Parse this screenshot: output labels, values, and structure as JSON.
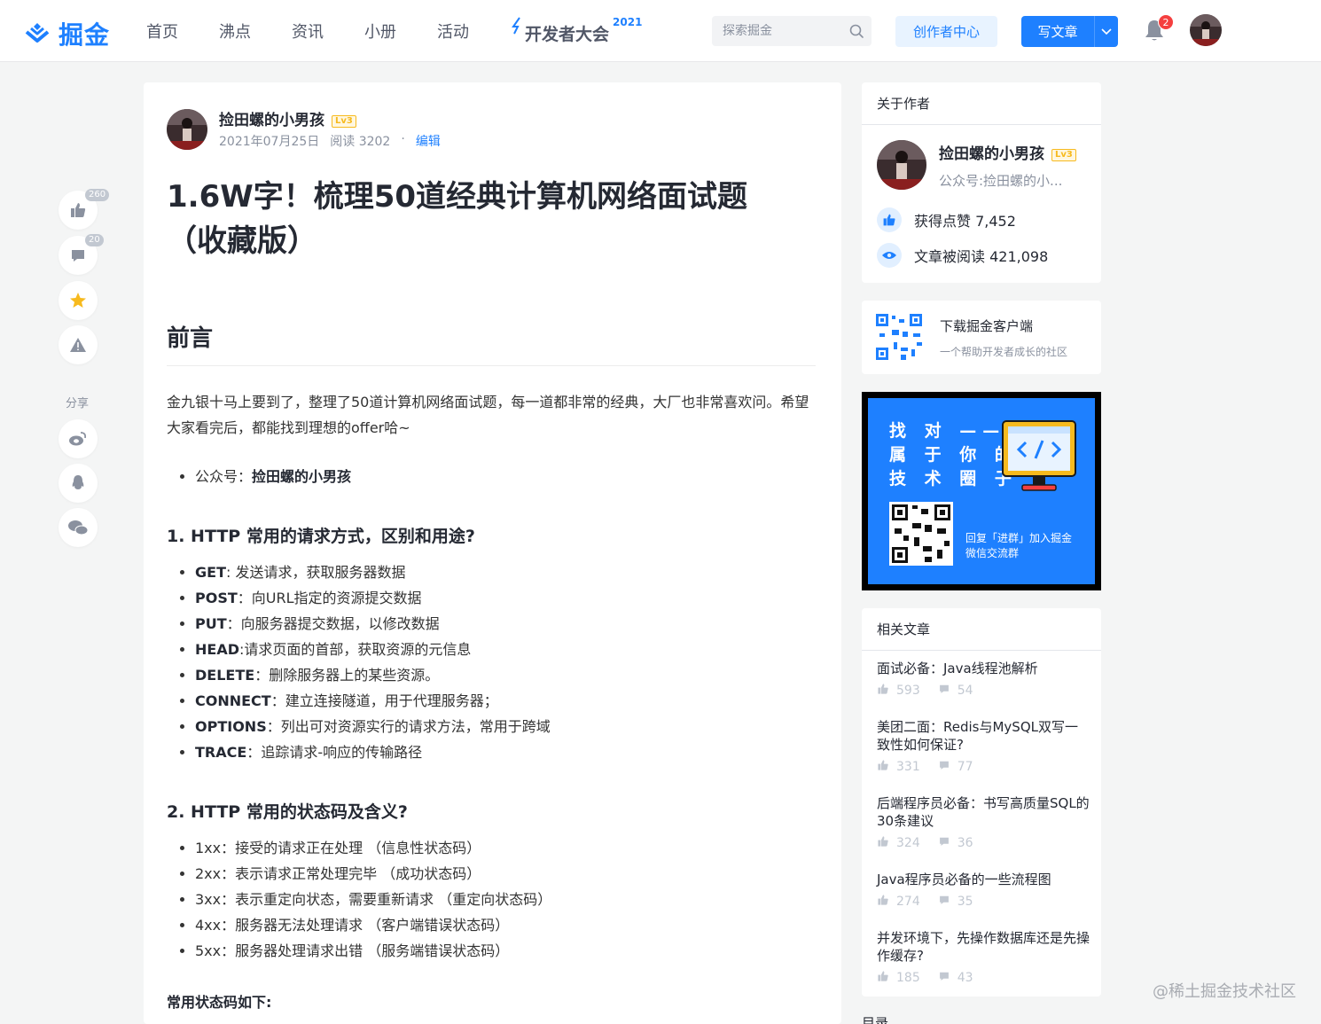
{
  "header": {
    "logo_text": "掘金",
    "nav": [
      "首页",
      "沸点",
      "资讯",
      "小册",
      "活动"
    ],
    "conference": "开发者大会",
    "conference_year": "2021",
    "search_placeholder": "探索掘金",
    "creator_center": "创作者中心",
    "write_article": "写文章",
    "notification_count": "2",
    "accent_color": "#1e80ff"
  },
  "side_actions": {
    "like_count": "260",
    "comment_count": "20",
    "share_label": "分享"
  },
  "article": {
    "author": "捡田螺的小男孩",
    "author_level": "Lv3",
    "date": "2021年07月25日",
    "views": "阅读 3202",
    "dot": "·",
    "edit": "编辑",
    "title": "1.6W字！梳理50道经典计算机网络面试题（收藏版）",
    "section_preface": "前言",
    "intro": "金九银十马上要到了，整理了50道计算机网络面试题，每一道都非常的经典，大厂也非常喜欢问。希望大家看完后，都能找到理想的offer哈~",
    "account_prefix": "公众号：",
    "account_name": "捡田螺的小男孩",
    "q1_title": "1. HTTP 常用的请求方式，区别和用途?",
    "q1_items": [
      {
        "key": "GET",
        "sep": ": ",
        "text": "发送请求，获取服务器数据"
      },
      {
        "key": "POST",
        "sep": "：",
        "text": "向URL指定的资源提交数据"
      },
      {
        "key": "PUT",
        "sep": "：",
        "text": "向服务器提交数据，以修改数据"
      },
      {
        "key": "HEAD",
        "sep": ":",
        "text": "请求页面的首部，获取资源的元信息"
      },
      {
        "key": "DELETE",
        "sep": "：",
        "text": "删除服务器上的某些资源。"
      },
      {
        "key": "CONNECT",
        "sep": "：",
        "text": "建立连接隧道，用于代理服务器；"
      },
      {
        "key": "OPTIONS",
        "sep": "：",
        "text": "列出可对资源实行的请求方法，常用于跨域"
      },
      {
        "key": "TRACE",
        "sep": "：",
        "text": "追踪请求-响应的传输路径"
      }
    ],
    "q2_title": "2. HTTP 常用的状态码及含义?",
    "q2_items": [
      "1xx：接受的请求正在处理 （信息性状态码）",
      "2xx：表示请求正常处理完毕 （成功状态码）",
      "3xx：表示重定向状态，需要重新请求 （重定向状态码）",
      "4xx：服务器无法处理请求 （客户端错误状态码）",
      "5xx：服务器处理请求出错 （服务端错误状态码）"
    ],
    "common_codes": "常用状态码如下:"
  },
  "about_author": {
    "heading": "关于作者",
    "name": "捡田螺的小男孩",
    "level": "Lv3",
    "subtitle": "公众号:捡田螺的小...",
    "likes": "获得点赞 7,452",
    "reads": "文章被阅读 421,098"
  },
  "download": {
    "title": "下载掘金客户端",
    "subtitle": "一个帮助开发者成长的社区"
  },
  "promo": {
    "lines": [
      "找 对 ——",
      "属 于 你 的",
      "技 术 圈 子"
    ],
    "caption_1": "回复「进群」加入掘金",
    "caption_2": "微信交流群"
  },
  "related": {
    "heading": "相关文章",
    "items": [
      {
        "title": "面试必备：Java线程池解析",
        "likes": "593",
        "comments": "54"
      },
      {
        "title": "美团二面：Redis与MySQL双写一致性如何保证?",
        "likes": "331",
        "comments": "77"
      },
      {
        "title": "后端程序员必备：书写高质量SQL的30条建议",
        "likes": "324",
        "comments": "36"
      },
      {
        "title": "Java程序员必备的一些流程图",
        "likes": "274",
        "comments": "35"
      },
      {
        "title": "并发环境下，先操作数据库还是先操作缓存?",
        "likes": "185",
        "comments": "43"
      }
    ]
  },
  "toc_label": "目录",
  "watermark": "@稀土掘金技术社区"
}
